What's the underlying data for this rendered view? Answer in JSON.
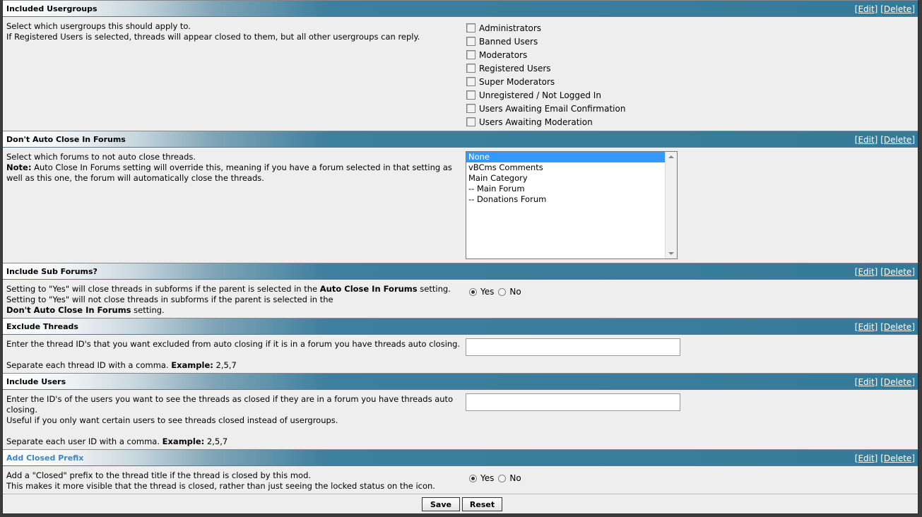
{
  "links": {
    "edit": "[Edit]",
    "delete": "[Delete]"
  },
  "sections": [
    {
      "title": "Included Usergroups",
      "desc": [
        "Select which usergroups this should apply to.",
        "If Registered Users is selected, threads will appear closed to them, but all other usergroups can reply."
      ],
      "options": [
        "Administrators",
        "Banned Users",
        "Moderators",
        "Registered Users",
        "Super Moderators",
        "Unregistered / Not Logged In",
        "Users Awaiting Email Confirmation",
        "Users Awaiting Moderation"
      ]
    },
    {
      "title": "Don't Auto Close In Forums",
      "desc_line1": "Select which forums to not auto close threads.",
      "note_label": "Note:",
      "note_text": " Auto Close In Forums setting will override this, meaning if you have a forum selected in that setting as",
      "desc_line3": "well as this one, the forum will automatically close the threads.",
      "forums": [
        "None",
        "vBCms Comments",
        "Main Category",
        "-- Main Forum",
        "-- Donations Forum"
      ],
      "selected": "None"
    },
    {
      "title": "Include Sub Forums?",
      "l1a": "Setting to \"Yes\" will close threads in subforms if the parent is selected in the ",
      "l1b": "Auto Close In Forums",
      "l1c": " setting.",
      "l2": "Setting to \"Yes\" will not close threads in subforms if the parent is selected in the",
      "l3a": "Don't Auto Close In Forums",
      "l3b": " setting.",
      "value": "Yes"
    },
    {
      "title": "Exclude Threads",
      "desc": "Enter the thread ID's that you want excluded from auto closing if it is in a forum you have threads auto closing.",
      "sep": "Separate each thread ID with a comma. ",
      "example_label": "Example:",
      "example_value": " 2,5,7",
      "input_value": ""
    },
    {
      "title": "Include Users",
      "d1": "Enter the ID's of the users you want to see the threads as closed if they are in a forum you have threads auto",
      "d2": "closing.",
      "d3": "Useful if you only want certain users to see threads closed instead of usergroups.",
      "sep": "Separate each user ID with a comma. ",
      "example_label": "Example:",
      "example_value": " 2,5,7",
      "input_value": ""
    },
    {
      "title": "Add Closed Prefix",
      "d1": "Add a \"Closed\" prefix to the thread title if the thread is closed by this mod.",
      "d2": "This makes it more visible that the thread is closed, rather than just seeing the locked status on the icon.",
      "value": "Yes"
    }
  ],
  "radio": {
    "yes": "Yes",
    "no": "No"
  },
  "buttons": {
    "save": "Save",
    "reset": "Reset"
  }
}
